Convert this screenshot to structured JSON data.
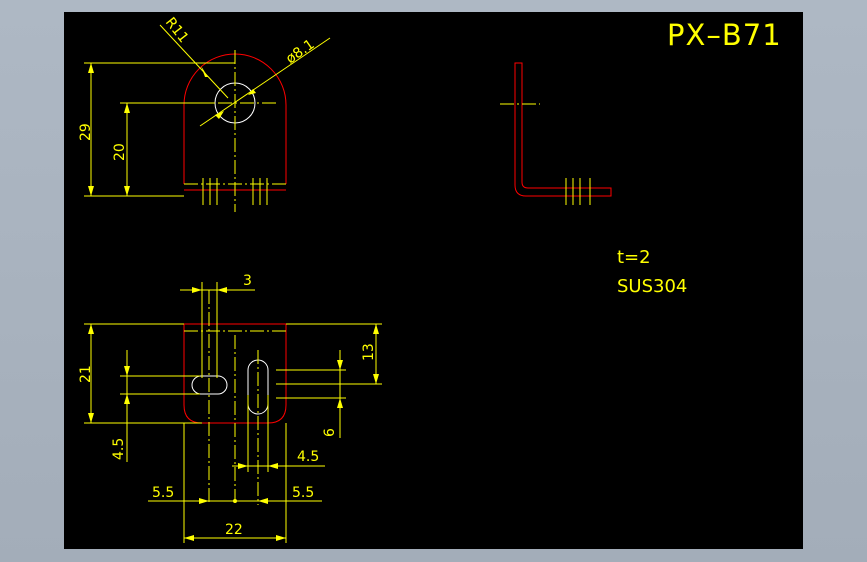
{
  "title": "PX–B71",
  "notes": {
    "thickness": "t=2",
    "material": "SUS304"
  },
  "dimensions": {
    "radius": "R11",
    "hole_diameter": "ø8.1",
    "height_total": "29",
    "height_hole": "20",
    "slot_width": "3",
    "height_bottom": "21",
    "slot_offset_top": "13",
    "slot_length": "6",
    "slot_offset_left": "4.5",
    "slot_half_right": "4.5",
    "left_edge_offset": "5.5",
    "right_edge_offset": "5.5",
    "width_total": "22"
  },
  "colors": {
    "outline": "#ff0000",
    "dimension": "#ffff00",
    "hidden": "#ffffff",
    "sheet": "#000000"
  }
}
